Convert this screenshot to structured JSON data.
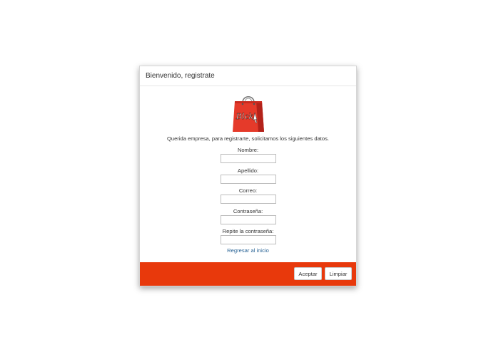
{
  "modal": {
    "title": "Bienvenido, registrate"
  },
  "logo": {
    "text": "Blck",
    "icon": "shopping-bag-icon",
    "colors": {
      "bag": "#e53a2a",
      "bag_dark": "#b3221a",
      "handle": "#777777"
    }
  },
  "intro": "Querida empresa, para registrarte, solicitamos los siguientes datos.",
  "fields": [
    {
      "label": "Nombre:",
      "value": ""
    },
    {
      "label": "Apellido:",
      "value": ""
    },
    {
      "label": "Correo:",
      "value": ""
    },
    {
      "label": "Contraseña:",
      "value": ""
    },
    {
      "label": "Repite la contraseña:",
      "value": ""
    }
  ],
  "back_link": "Regresar al inicio",
  "footer": {
    "color": "#e8390c",
    "accept_label": "Aceptar",
    "clear_label": "Limpiar"
  }
}
